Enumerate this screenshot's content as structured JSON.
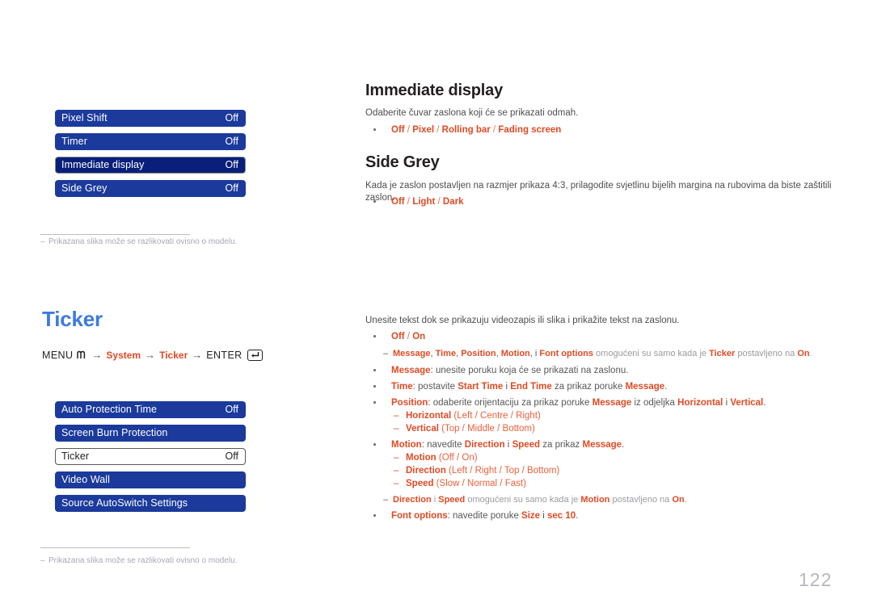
{
  "page": {
    "number": "122"
  },
  "osd_top": {
    "rows": [
      {
        "label": "Pixel Shift",
        "value": "Off",
        "state": "normal"
      },
      {
        "label": "Timer",
        "value": "Off",
        "state": "normal"
      },
      {
        "label": "Immediate display",
        "value": "Off",
        "state": "selected-dark"
      },
      {
        "label": "Side Grey",
        "value": "Off",
        "state": "normal"
      }
    ],
    "footnote": "Prikazana slika može se razlikovati ovisno o modelu."
  },
  "osd_bottom": {
    "rows": [
      {
        "label": "Auto Protection Time",
        "value": "Off",
        "state": "normal"
      },
      {
        "label": "Screen Burn Protection",
        "value": "",
        "state": "normal"
      },
      {
        "label": "Ticker",
        "value": "Off",
        "state": "selected-white"
      },
      {
        "label": "Video Wall",
        "value": "",
        "state": "normal"
      },
      {
        "label": "Source AutoSwitch Settings",
        "value": "",
        "state": "normal"
      }
    ],
    "footnote": "Prikazana slika može se razlikovati ovisno o modelu."
  },
  "sections": {
    "immediate_display": {
      "heading": "Immediate display",
      "paragraph": "Odaberite čuvar zaslona koji će se prikazati odmah.",
      "options": {
        "o1": "Off",
        "s1": " / ",
        "o2": "Pixel",
        "s2": " / ",
        "o3": "Rolling bar",
        "s3": " / ",
        "o4": "Fading screen"
      }
    },
    "side_grey": {
      "heading": "Side Grey",
      "paragraph": "Kada je zaslon postavljen na razmjer prikaza 4:3, prilagodite svjetlinu bijelih margina na rubovima da biste zaštitili zaslon.",
      "options": {
        "o1": "Off",
        "s1": " / ",
        "o2": "Light",
        "s2": " / ",
        "o3": "Dark"
      }
    },
    "ticker": {
      "heading": "Ticker",
      "menu_path": {
        "menu_word": "MENU",
        "menu_glyph": "menu-icon",
        "arrow": "→",
        "item1": "System",
        "item2": "Ticker",
        "enter_word": "ENTER",
        "enter_glyph": "enter-key-icon"
      },
      "paragraph": "Unesite tekst dok se prikazuju videozapis ili slika i prikažite tekst na zaslonu.",
      "options": {
        "o1": "Off",
        "s1": " / ",
        "o2": "On"
      },
      "note1": {
        "t1": "Message",
        "t2": ", ",
        "t3": "Time",
        "t4": ", ",
        "t5": "Position",
        "t6": ", ",
        "t7": "Motion",
        "t8": ", i ",
        "t9": "Font options",
        "t10": " omogućeni su samo kada je ",
        "t11": "Ticker",
        "t12": " postavljeno na ",
        "t13": "On",
        "t14": "."
      },
      "items": {
        "message": {
          "term": "Message",
          "rest": ": unesite poruku koja će se prikazati na zaslonu."
        },
        "time": {
          "term": "Time",
          "a": ": postavite ",
          "b": "Start Time",
          "c": " i ",
          "d": "End Time",
          "e": " za prikaz poruke ",
          "f": "Message",
          "g": "."
        },
        "position": {
          "term": "Position",
          "a": ": odaberite orijentaciju za prikaz poruke ",
          "b": "Message",
          "c": " iz odjeljka ",
          "d": "Horizontal",
          "e": " i ",
          "f": "Vertical",
          "g": "."
        },
        "horizontal": {
          "term": "Horizontal",
          "opts": " (Left / Centre / Right)"
        },
        "vertical": {
          "term": "Vertical",
          "opts": " (Top / Middle / Bottom)"
        },
        "motion": {
          "term": "Motion",
          "a": ": navedite ",
          "b": "Direction",
          "c": " i ",
          "d": "Speed",
          "e": " za prikaz ",
          "f": "Message",
          "g": "."
        },
        "motion_sub": {
          "term": "Motion",
          "opts": " (Off / On)"
        },
        "direction_sub": {
          "term": "Direction",
          "opts": " (Left / Right / Top / Bottom)"
        },
        "speed_sub": {
          "term": "Speed",
          "opts": " (Slow / Normal / Fast)"
        },
        "font_options": {
          "term": "Font options",
          "a": ": navedite poruke ",
          "b": "Size",
          "c": " i ",
          "d": "sec 10",
          "e": "."
        }
      },
      "note2": {
        "t1": "Direction",
        "t2": " i ",
        "t3": "Speed",
        "t4": " omogućeni su samo kada je ",
        "t5": "Motion",
        "t6": " postavljeno na ",
        "t7": "On",
        "t8": "."
      }
    }
  },
  "colors": {
    "osd_blue": "#1b3a9c",
    "osd_selected_dark": "#0a1f7a",
    "accent_orange": "#e04a24",
    "heading_blue": "#3d7ae0",
    "body_gray": "#58585b"
  }
}
